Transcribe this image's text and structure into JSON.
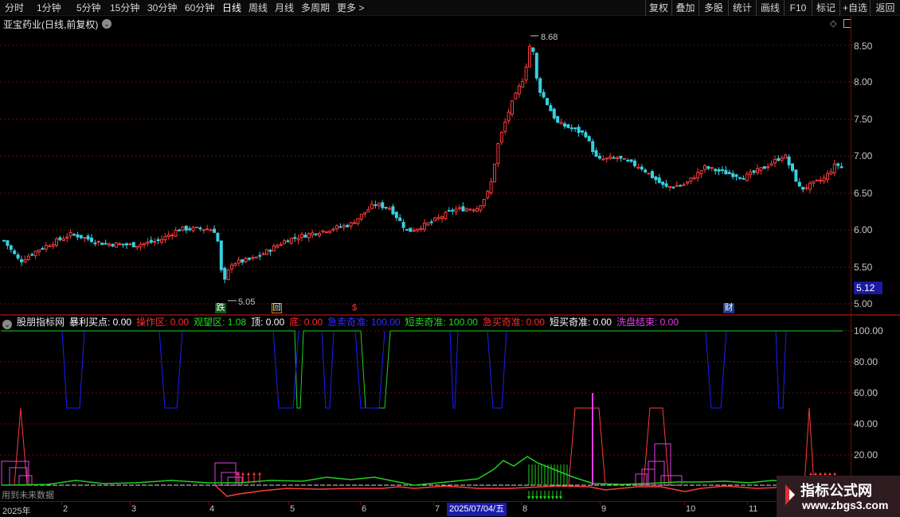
{
  "toolbar": {
    "periods": [
      "分时",
      "1分钟",
      "5分钟",
      "15分钟",
      "30分钟",
      "60分钟",
      "日线",
      "周线",
      "月线",
      "多周期",
      "更多 >"
    ],
    "active_period": "日线",
    "right_buttons": [
      "复权",
      "叠加",
      "多股",
      "统计",
      "画线",
      "F10",
      "标记",
      "+自选",
      "返回"
    ]
  },
  "stock": {
    "title": "亚宝药业(日线,前复权)",
    "high_label": "8.68",
    "low_label": "5.05",
    "current_price": "5.12"
  },
  "price_axis": [
    "8.50",
    "8.00",
    "7.50",
    "7.00",
    "6.50",
    "6.00",
    "5.50",
    "5.00"
  ],
  "event_marks": {
    "die": "跌",
    "hui": "回",
    "dollar": "$",
    "cai": "财"
  },
  "indicator": {
    "name": "股朋指标网",
    "items": [
      {
        "label": "暴利买点: 0.00",
        "color": "#ffffff"
      },
      {
        "label": "操作区: 0.00",
        "color": "#ff2a2a"
      },
      {
        "label": "观望区: 1.08",
        "color": "#22dd22"
      },
      {
        "label": "顶: 0.00",
        "color": "#ffffff"
      },
      {
        "label": "底: 0.00",
        "color": "#ff2a2a"
      },
      {
        "label": "急卖奇准: 100.00",
        "color": "#3030ff"
      },
      {
        "label": "短卖奇准: 100.00",
        "color": "#22dd22"
      },
      {
        "label": "急买奇准: 0.00",
        "color": "#ff2a2a"
      },
      {
        "label": "短买奇准: 0.00",
        "color": "#ffffff"
      },
      {
        "label": "洗盘结束: 0.00",
        "color": "#e040e0"
      }
    ],
    "axis": [
      "100.00",
      "80.00",
      "60.00",
      "40.00",
      "20.00"
    ],
    "future_note": "用到未来数据"
  },
  "dates": {
    "labels": [
      "2025年",
      "2",
      "3",
      "4",
      "5",
      "6",
      "7",
      "8",
      "9",
      "10",
      "11"
    ],
    "cursor": "2025/07/04/五"
  },
  "watermark": {
    "title": "指标公式网",
    "url": "www.zbgs3.com"
  },
  "colors": {
    "up": "#ff3b3b",
    "down": "#36d0e0",
    "frame": "#6e0d0d",
    "blue": "#1c1cff",
    "green": "#1fd01f",
    "magenta": "#e040e0"
  }
}
